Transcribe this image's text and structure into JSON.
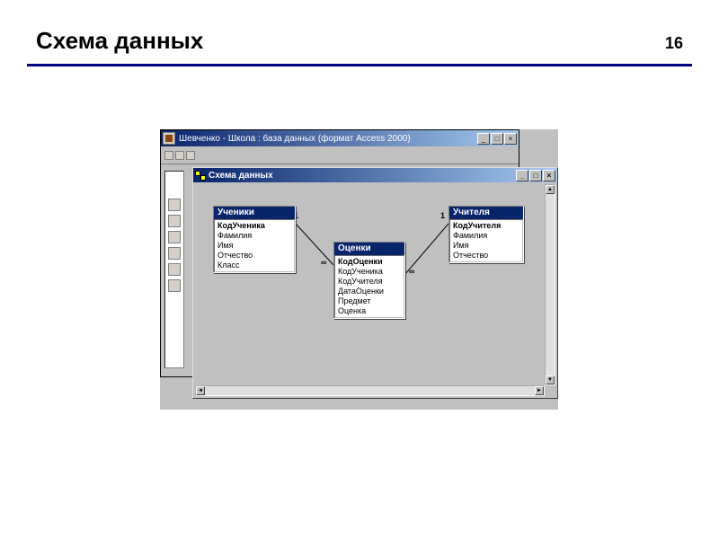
{
  "page": {
    "title": "Схема данных",
    "number": "16"
  },
  "parent_window": {
    "title": "Шевченко - Школа : база данных (формат Access 2000)"
  },
  "schema_window": {
    "title": "Схема данных"
  },
  "tables": {
    "students": {
      "name": "Ученики",
      "fields": [
        "КодУченика",
        "Фамилия",
        "Имя",
        "Отчество",
        "Класс"
      ],
      "pk_index": 0
    },
    "grades": {
      "name": "Оценки",
      "fields": [
        "КодОценки",
        "КодУченика",
        "КодУчителя",
        "ДатаОценки",
        "Предмет",
        "Оценка"
      ],
      "pk_index": 0
    },
    "teachers": {
      "name": "Учителя",
      "fields": [
        "КодУчителя",
        "Фамилия",
        "Имя",
        "Отчество"
      ],
      "pk_index": 0
    }
  },
  "relationships": [
    {
      "from": "students",
      "to": "grades",
      "card_from": "1",
      "card_to": "∞"
    },
    {
      "from": "teachers",
      "to": "grades",
      "card_from": "1",
      "card_to": "∞"
    }
  ],
  "chart_data": {
    "type": "table",
    "description": "Entity-relationship diagram (Access relationships view)",
    "entities": [
      {
        "name": "Ученики",
        "pk": "КодУченика",
        "fields": [
          "КодУченика",
          "Фамилия",
          "Имя",
          "Отчество",
          "Класс"
        ]
      },
      {
        "name": "Оценки",
        "pk": "КодОценки",
        "fields": [
          "КодОценки",
          "КодУченика",
          "КодУчителя",
          "ДатаОценки",
          "Предмет",
          "Оценка"
        ]
      },
      {
        "name": "Учителя",
        "pk": "КодУчителя",
        "fields": [
          "КодУчителя",
          "Фамилия",
          "Имя",
          "Отчество"
        ]
      }
    ],
    "relationships": [
      {
        "from": "Ученики.КодУченика",
        "to": "Оценки.КодУченика",
        "cardinality": "1:∞"
      },
      {
        "from": "Учителя.КодУчителя",
        "to": "Оценки.КодУчителя",
        "cardinality": "1:∞"
      }
    ]
  },
  "labels": {
    "rel1_one": "1",
    "rel1_many": "∞",
    "rel2_one": "1",
    "rel2_many": "∞"
  }
}
